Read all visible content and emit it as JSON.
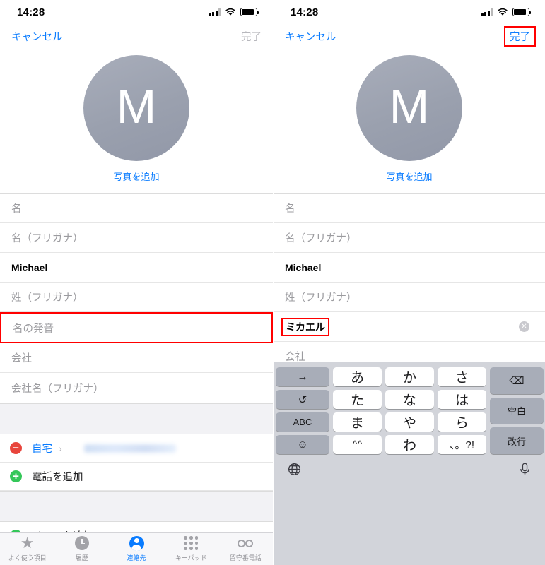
{
  "status": {
    "time": "14:28"
  },
  "nav": {
    "cancel": "キャンセル",
    "done": "完了"
  },
  "avatar": {
    "initial": "M",
    "add_photo": "写真を追加"
  },
  "fields": {
    "first_name": "名",
    "first_name_kana": "名（フリガナ）",
    "last_name_value": "Michael",
    "last_name_kana": "姓（フリガナ）",
    "pronunciation_placeholder": "名の発音",
    "pronunciation_value": "ミカエル",
    "company": "会社",
    "company_kana": "会社名（フリガナ）"
  },
  "contact": {
    "phone_label": "自宅",
    "add_phone": "電話を追加",
    "add_email": "メールを追加"
  },
  "tabs": [
    {
      "label": "よく使う項目",
      "icon": "star-icon",
      "active": false
    },
    {
      "label": "履歴",
      "icon": "clock-icon",
      "active": false
    },
    {
      "label": "連絡先",
      "icon": "person-icon",
      "active": true
    },
    {
      "label": "キーパッド",
      "icon": "keypad-icon",
      "active": false
    },
    {
      "label": "留守番電話",
      "icon": "voicemail-icon",
      "active": false
    }
  ],
  "keyboard": {
    "row1": {
      "fn_left": "→",
      "k1": "あ",
      "k2": "か",
      "k3": "さ",
      "fn_right": "⌫"
    },
    "row2": {
      "fn_left": "↺",
      "k1": "た",
      "k2": "な",
      "k3": "は",
      "fn_right": "空白"
    },
    "row3": {
      "fn_left": "ABC",
      "k1": "ま",
      "k2": "や",
      "k3": "ら",
      "fn_right": "改行"
    },
    "row4": {
      "fn_left": "☺",
      "k1": "^^",
      "k2": "わ",
      "k3": "、。?!"
    },
    "globe": "globe-icon",
    "mic": "microphone-icon"
  },
  "colors": {
    "accent": "#0a7cff",
    "highlight": "#ff0000",
    "avatar": "#9aa0ae",
    "delete": "#e8453c",
    "add": "#34c759"
  }
}
